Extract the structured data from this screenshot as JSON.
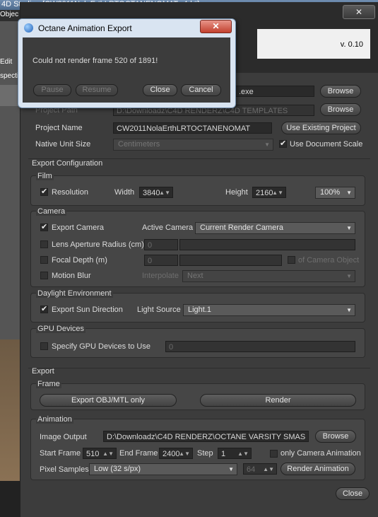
{
  "app_title": "4D Studio - [CW2011NolaErthLRTOCTANENOMAT.c4d *]",
  "left_strip": {
    "menu_label": "Objec",
    "edit_label": "Edit",
    "view_label": "spectiv"
  },
  "panel": {
    "close_label": "✕",
    "version": "v. 0.10",
    "octane_path": ".exe",
    "browse_label": "Browse",
    "project_path_label": "Project Path",
    "project_path_value": "D:\\Downloadz\\C4D RENDERZ\\C4D TEMPLATES",
    "project_name_label": "Project Name",
    "project_name_value": "CW2011NolaErthLRTOCTANENOMAT",
    "use_existing_label": "Use Existing Project",
    "native_unit_label": "Native Unit Size",
    "native_unit_value": "Centimeters",
    "use_doc_scale_label": "Use Document Scale"
  },
  "export_config": {
    "title": "Export Configuration",
    "film": {
      "title": "Film",
      "resolution_label": "Resolution",
      "width_label": "Width",
      "width_value": "3840",
      "height_label": "Height",
      "height_value": "2160",
      "zoom_value": "100%"
    },
    "camera": {
      "title": "Camera",
      "export_camera_label": "Export Camera",
      "active_camera_label": "Active Camera",
      "active_camera_value": "Current Render Camera",
      "lens_label": "Lens Aperture Radius (cm)",
      "lens_value": "0",
      "focal_label": "Focal Depth (m)",
      "focal_value": "0",
      "of_camera_label": "of Camera Object",
      "motion_blur_label": "Motion Blur",
      "interpolate_label": "Interpolate",
      "interpolate_value": "Next"
    },
    "daylight": {
      "title": "Daylight Environment",
      "export_sun_label": "Export Sun Direction",
      "light_source_label": "Light Source",
      "light_source_value": "Light.1"
    },
    "gpu": {
      "title": "GPU Devices",
      "specify_label": "Specify GPU Devices to Use",
      "value": "0"
    }
  },
  "export": {
    "title": "Export",
    "frame": {
      "title": "Frame",
      "obj_label": "Export OBJ/MTL only",
      "render_label": "Render"
    },
    "animation": {
      "title": "Animation",
      "image_output_label": "Image Output",
      "image_output_value": "D:\\Downloadz\\C4D RENDERZ\\OCTANE VARSITY SMAS",
      "browse_label": "Browse",
      "start_label": "Start Frame",
      "start_value": "510",
      "end_label": "End Frame",
      "end_value": "2400",
      "step_label": "Step",
      "step_value": "1",
      "only_camera_label": "only Camera Animation",
      "pixel_samples_label": "Pixel Samples",
      "pixel_samples_value": "Low (32 s/px)",
      "samples_value": "64",
      "render_anim_label": "Render Animation"
    }
  },
  "close_button_label": "Close",
  "dialog": {
    "title": "Octane Animation Export",
    "close_x": "✕",
    "message": "Could not render frame 520 of 1891!",
    "pause_label": "Pause",
    "resume_label": "Resume",
    "close_label": "Close",
    "cancel_label": "Cancel"
  }
}
